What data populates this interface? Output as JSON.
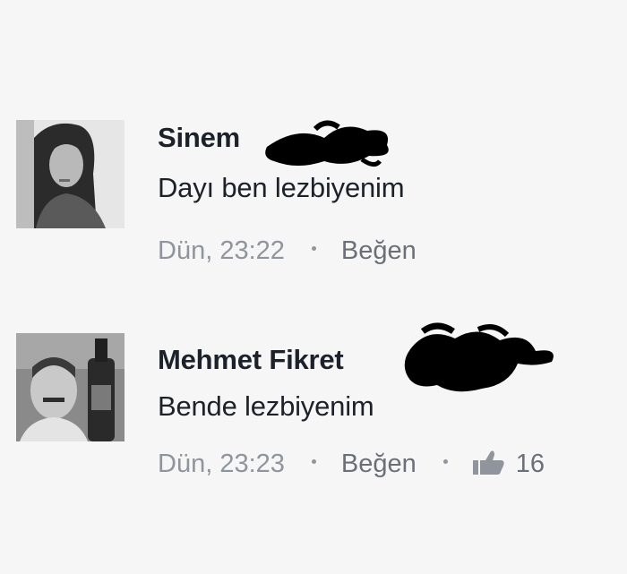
{
  "comments": [
    {
      "author": "Sinem",
      "text": "Dayı ben lezbiyenim",
      "time": "Dün, 23:22",
      "separator": "·",
      "like_label": "Beğen"
    },
    {
      "author": "Mehmet Fikret",
      "text": "Bende lezbiyenim",
      "time": "Dün, 23:23",
      "separator": "·",
      "like_label": "Beğen",
      "like_icon": "thumbs-up-icon",
      "like_count": "16"
    }
  ],
  "colors": {
    "background": "#f6f6f7",
    "name_text": "#1d2129",
    "meta_text": "#90949c",
    "redaction": "#000000"
  }
}
